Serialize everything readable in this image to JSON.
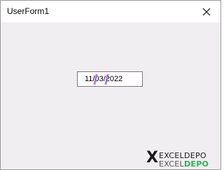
{
  "window": {
    "title": "UserForm1"
  },
  "textbox": {
    "value": "11/03/2022"
  },
  "watermark": {
    "line1": "EXCELDEPO",
    "line2_a": "EXCEL",
    "line2_b": "DEPO"
  },
  "colors": {
    "background": "#f0eef1",
    "titlebar": "#ffffff",
    "selection_marks": "#a66be3",
    "logo_accent": "#2fae5a"
  }
}
